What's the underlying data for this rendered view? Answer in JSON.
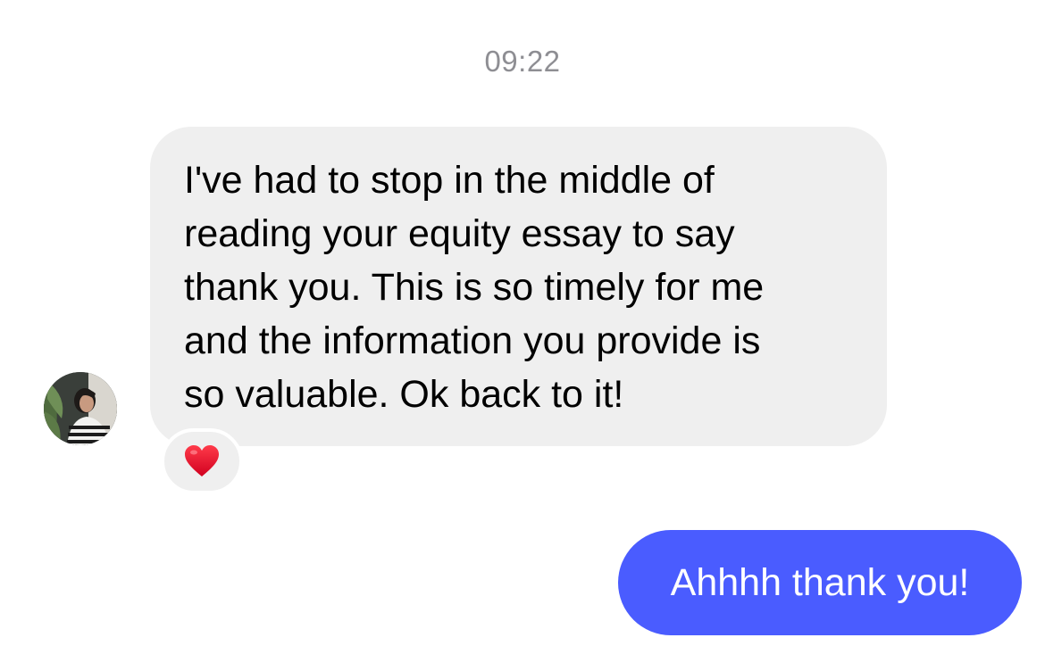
{
  "conversation": {
    "timestamp": "09:22",
    "incoming": {
      "text": "I've had to stop in the middle of\nreading your equity essay to say\nthank you. This is so timely for me\nand the information you provide is\nso valuable. Ok back to it!",
      "reaction_icon": "red-heart",
      "avatar_icon": "profile-photo",
      "bubble_color": "#efefef"
    },
    "outgoing": {
      "text": "Ahhhh thank you!",
      "bubble_color": "#4a5cff"
    }
  }
}
